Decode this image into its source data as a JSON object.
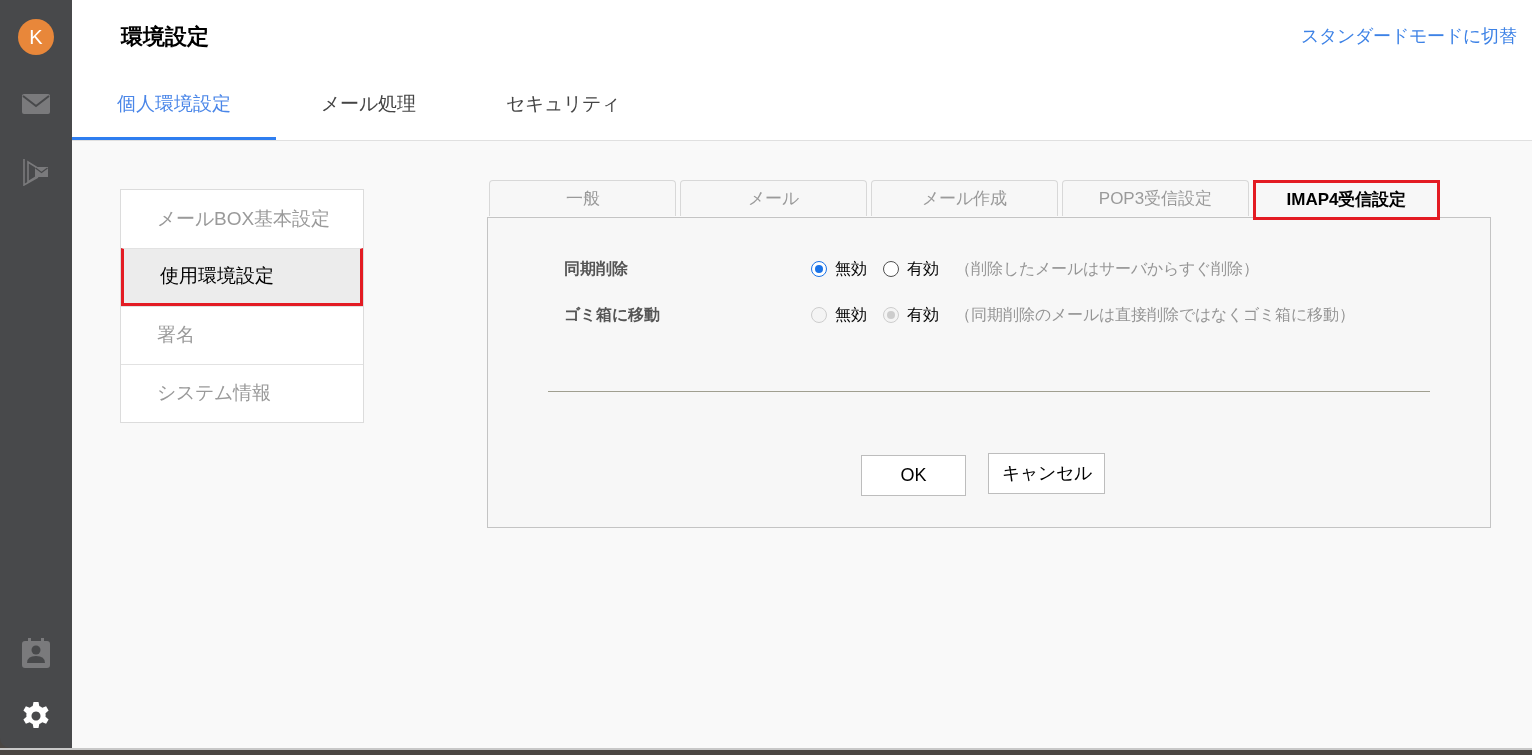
{
  "sidebar": {
    "avatar_initial": "K",
    "settings_selected": true
  },
  "header": {
    "title": "環境設定",
    "mode_link": "スタンダードモードに切替"
  },
  "tabs": [
    {
      "label": "個人環境設定",
      "selected": true
    },
    {
      "label": "メール処理",
      "selected": false
    },
    {
      "label": "セキュリティ",
      "selected": false
    }
  ],
  "menu": {
    "items": [
      {
        "label": "メールBOX基本設定",
        "selected": false
      },
      {
        "label": "使用環境設定",
        "selected": true
      },
      {
        "label": "署名",
        "selected": false
      },
      {
        "label": "システム情報",
        "selected": false
      }
    ]
  },
  "subtabs": [
    {
      "label": "一般",
      "selected": false
    },
    {
      "label": "メール",
      "selected": false
    },
    {
      "label": "メール作成",
      "selected": false
    },
    {
      "label": "POP3受信設定",
      "selected": false
    },
    {
      "label": "IMAP4受信設定",
      "selected": true
    }
  ],
  "settings": {
    "rows": [
      {
        "label": "同期削除",
        "disabled": false,
        "options": [
          {
            "label": "無効",
            "selected": true
          },
          {
            "label": "有効",
            "selected": false
          }
        ],
        "note": "（削除したメールはサーバからすぐ削除）"
      },
      {
        "label": "ゴミ箱に移動",
        "disabled": true,
        "options": [
          {
            "label": "無効",
            "selected": false
          },
          {
            "label": "有効",
            "selected": true
          }
        ],
        "note": "（同期削除のメールは直接削除ではなくゴミ箱に移動）"
      }
    ]
  },
  "buttons": [
    {
      "label": "OK"
    },
    {
      "label": "キャンセル"
    }
  ]
}
